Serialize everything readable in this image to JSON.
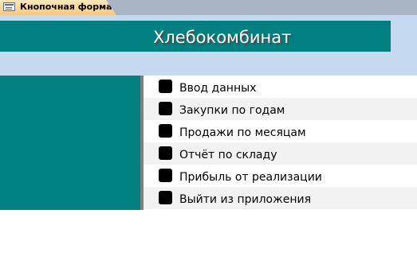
{
  "tab": {
    "label": "Кнопочная форма",
    "icon": "form-icon"
  },
  "header": {
    "title": "Хлебокомбинат"
  },
  "colors": {
    "teal": "#008080",
    "band": "#c5d9f1",
    "alt_row": "#f2f2f2"
  },
  "menu": {
    "items": [
      {
        "label": "Ввод данных"
      },
      {
        "label": "Закупки по годам"
      },
      {
        "label": "Продажи по месяцам"
      },
      {
        "label": "Отчёт по складу"
      },
      {
        "label": "Прибыль от реализации"
      },
      {
        "label": "Выйти из приложения"
      }
    ]
  }
}
